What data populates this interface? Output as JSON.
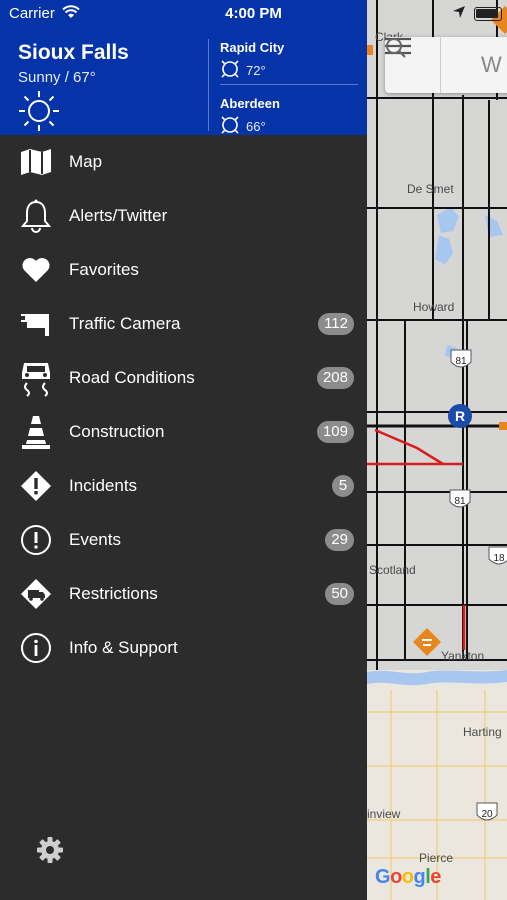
{
  "status_bar": {
    "carrier": "Carrier",
    "time": "4:00 PM"
  },
  "weather": {
    "primary": {
      "city": "Sioux Falls",
      "condition": "Sunny / 67°",
      "icon": "sun-icon"
    },
    "secondary": [
      {
        "city": "Rapid City",
        "temp": "72°",
        "icon": "sun-outline-icon"
      },
      {
        "city": "Aberdeen",
        "temp": "66°",
        "icon": "sun-outline-icon"
      }
    ]
  },
  "menu": [
    {
      "label": "Map",
      "icon": "map-icon",
      "badge": ""
    },
    {
      "label": "Alerts/Twitter",
      "icon": "bell-icon",
      "badge": ""
    },
    {
      "label": "Favorites",
      "icon": "heart-icon",
      "badge": ""
    },
    {
      "label": "Traffic Camera",
      "icon": "traffic-camera-icon",
      "badge": "112"
    },
    {
      "label": "Road Conditions",
      "icon": "road-conditions-icon",
      "badge": "208"
    },
    {
      "label": "Construction",
      "icon": "traffic-cone-icon",
      "badge": "109"
    },
    {
      "label": "Incidents",
      "icon": "warning-diamond-icon",
      "badge": "5"
    },
    {
      "label": "Events",
      "icon": "exclamation-circle-icon",
      "badge": "29"
    },
    {
      "label": "Restrictions",
      "icon": "truck-restriction-icon",
      "badge": "50"
    },
    {
      "label": "Info & Support",
      "icon": "info-icon",
      "badge": ""
    }
  ],
  "map": {
    "search_placeholder": "W",
    "places": [
      "Clark",
      "De Smet",
      "Howard",
      "Scotland",
      "Yankton",
      "Harting",
      "inview",
      "Pierce"
    ],
    "route_shields": [
      "81",
      "81",
      "18",
      "20"
    ],
    "marker_letter": "R",
    "attribution": "Google"
  },
  "colors": {
    "header_blue": "#0533a8",
    "drawer_bg": "#2c2c2c",
    "badge_gray": "#8c8c8c",
    "alert_orange": "#e8861e",
    "closure_red": "#d81c1c"
  }
}
